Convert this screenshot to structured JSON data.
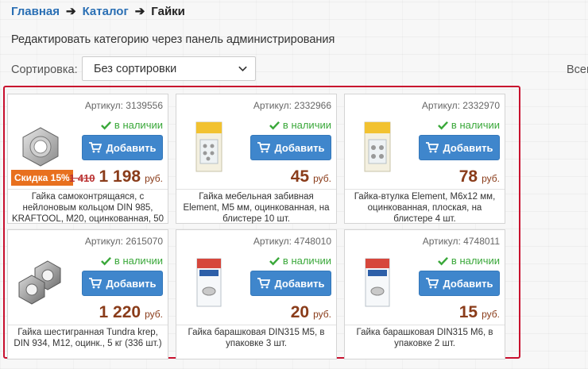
{
  "breadcrumb": {
    "home": "Главная",
    "catalog": "Каталог",
    "current": "Гайки"
  },
  "admin_link": "Редактировать категорию через панель администрирования",
  "sort": {
    "label": "Сортировка:",
    "value": "Без сортировки"
  },
  "right_cut_text": "Всег",
  "stock_text": "в наличии",
  "add_label": "Добавить",
  "currency": "руб.",
  "colors": {
    "accent_blue": "#3f86cc",
    "price": "#8a3c1a",
    "stock_green": "#3aa83a",
    "frame_red": "#c8102e",
    "discount_orange": "#e8701e"
  },
  "products": [
    {
      "sku": "Артикул: 3139556",
      "price": "1 198",
      "old_price": "1 410",
      "discount": "Скидка 15%",
      "title": "Гайка самоконтрящаяся, с нейлоновым кольцом DIN 985, KRAFTOOL, M20, оцинкованная, 50",
      "image_icon": "nylon-lock-nut-icon"
    },
    {
      "sku": "Артикул: 2332966",
      "price": "45",
      "title": "Гайка мебельная забивная Element, M5 мм, оцинкованная, на блистере 10 шт.",
      "image_icon": "blister-pack-icon"
    },
    {
      "sku": "Артикул: 2332970",
      "price": "78",
      "title": "Гайка-втулка Element, M6х12 мм, оцинкованная, плоская, на блистере 4 шт.",
      "image_icon": "blister-pack-icon"
    },
    {
      "sku": "Артикул: 2615070",
      "price": "1 220",
      "title": "Гайка шестигранная Tundra krep, DIN 934, M12, оцинк., 5 кг (336 шт.)",
      "image_icon": "hex-nut-icon"
    },
    {
      "sku": "Артикул: 4748010",
      "price": "20",
      "title": "Гайка барашковая DIN315 M5, в упаковке 3 шт.",
      "image_icon": "bag-pack-icon"
    },
    {
      "sku": "Артикул: 4748011",
      "price": "15",
      "title": "Гайка барашковая DIN315 M6, в упаковке 2 шт.",
      "image_icon": "bag-pack-icon"
    }
  ]
}
